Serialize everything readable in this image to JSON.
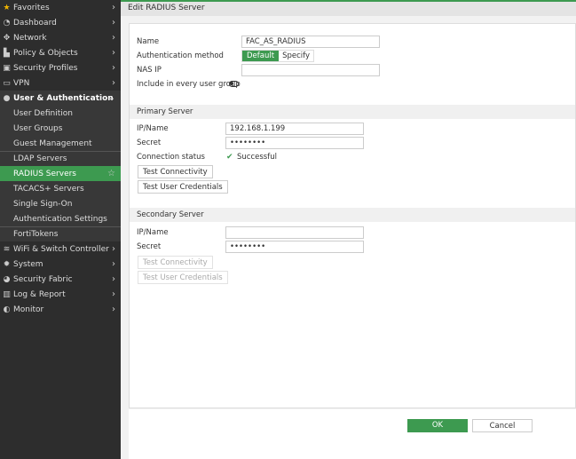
{
  "sidebar": {
    "items": [
      {
        "label": "Favorites",
        "icon": "star-icon"
      },
      {
        "label": "Dashboard",
        "icon": "dashboard-icon"
      },
      {
        "label": "Network",
        "icon": "network-icon"
      },
      {
        "label": "Policy & Objects",
        "icon": "policy-icon"
      },
      {
        "label": "Security Profiles",
        "icon": "lock-icon"
      },
      {
        "label": "VPN",
        "icon": "laptop-icon"
      },
      {
        "label": "User & Authentication",
        "icon": "user-icon"
      },
      {
        "label": "User Definition"
      },
      {
        "label": "User Groups"
      },
      {
        "label": "Guest Management"
      },
      {
        "label": "LDAP Servers"
      },
      {
        "label": "RADIUS Servers"
      },
      {
        "label": "TACACS+ Servers"
      },
      {
        "label": "Single Sign-On"
      },
      {
        "label": "Authentication Settings"
      },
      {
        "label": "FortiTokens"
      },
      {
        "label": "WiFi & Switch Controller",
        "icon": "wifi-icon"
      },
      {
        "label": "System",
        "icon": "gear-icon"
      },
      {
        "label": "Security Fabric",
        "icon": "fabric-icon"
      },
      {
        "label": "Log & Report",
        "icon": "chart-icon"
      },
      {
        "label": "Monitor",
        "icon": "monitor-icon"
      }
    ]
  },
  "page": {
    "title": "Edit RADIUS Server"
  },
  "form": {
    "name_label": "Name",
    "name_value": "FAC_AS_RADIUS",
    "auth_label": "Authentication method",
    "auth_default": "Default",
    "auth_specify": "Specify",
    "nasip_label": "NAS IP",
    "nasip_value": "",
    "include_label": "Include in every user group"
  },
  "primary": {
    "title": "Primary Server",
    "ip_label": "IP/Name",
    "ip_value": "192.168.1.199",
    "secret_label": "Secret",
    "secret_value": "••••••••",
    "status_label": "Connection status",
    "status_value": "Successful",
    "test_conn": "Test Connectivity",
    "test_user": "Test User Credentials"
  },
  "secondary": {
    "title": "Secondary Server",
    "ip_label": "IP/Name",
    "ip_value": "",
    "secret_label": "Secret",
    "secret_value": "••••••••",
    "test_conn": "Test Connectivity",
    "test_user": "Test User Credentials"
  },
  "footer": {
    "ok": "OK",
    "cancel": "Cancel"
  },
  "colors": {
    "accent": "#3d9a50",
    "sidebar": "#2d2d2d"
  }
}
